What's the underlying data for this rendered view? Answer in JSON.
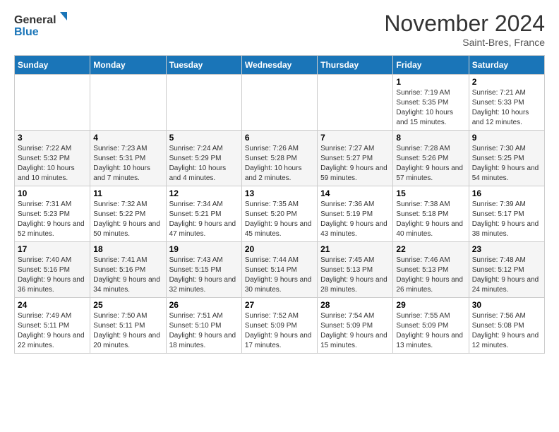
{
  "logo": {
    "name1": "General",
    "name2": "Blue"
  },
  "title": "November 2024",
  "subtitle": "Saint-Bres, France",
  "headers": [
    "Sunday",
    "Monday",
    "Tuesday",
    "Wednesday",
    "Thursday",
    "Friday",
    "Saturday"
  ],
  "rows": [
    [
      {
        "day": "",
        "info": ""
      },
      {
        "day": "",
        "info": ""
      },
      {
        "day": "",
        "info": ""
      },
      {
        "day": "",
        "info": ""
      },
      {
        "day": "",
        "info": ""
      },
      {
        "day": "1",
        "info": "Sunrise: 7:19 AM\nSunset: 5:35 PM\nDaylight: 10 hours and 15 minutes."
      },
      {
        "day": "2",
        "info": "Sunrise: 7:21 AM\nSunset: 5:33 PM\nDaylight: 10 hours and 12 minutes."
      }
    ],
    [
      {
        "day": "3",
        "info": "Sunrise: 7:22 AM\nSunset: 5:32 PM\nDaylight: 10 hours and 10 minutes."
      },
      {
        "day": "4",
        "info": "Sunrise: 7:23 AM\nSunset: 5:31 PM\nDaylight: 10 hours and 7 minutes."
      },
      {
        "day": "5",
        "info": "Sunrise: 7:24 AM\nSunset: 5:29 PM\nDaylight: 10 hours and 4 minutes."
      },
      {
        "day": "6",
        "info": "Sunrise: 7:26 AM\nSunset: 5:28 PM\nDaylight: 10 hours and 2 minutes."
      },
      {
        "day": "7",
        "info": "Sunrise: 7:27 AM\nSunset: 5:27 PM\nDaylight: 9 hours and 59 minutes."
      },
      {
        "day": "8",
        "info": "Sunrise: 7:28 AM\nSunset: 5:26 PM\nDaylight: 9 hours and 57 minutes."
      },
      {
        "day": "9",
        "info": "Sunrise: 7:30 AM\nSunset: 5:25 PM\nDaylight: 9 hours and 54 minutes."
      }
    ],
    [
      {
        "day": "10",
        "info": "Sunrise: 7:31 AM\nSunset: 5:23 PM\nDaylight: 9 hours and 52 minutes."
      },
      {
        "day": "11",
        "info": "Sunrise: 7:32 AM\nSunset: 5:22 PM\nDaylight: 9 hours and 50 minutes."
      },
      {
        "day": "12",
        "info": "Sunrise: 7:34 AM\nSunset: 5:21 PM\nDaylight: 9 hours and 47 minutes."
      },
      {
        "day": "13",
        "info": "Sunrise: 7:35 AM\nSunset: 5:20 PM\nDaylight: 9 hours and 45 minutes."
      },
      {
        "day": "14",
        "info": "Sunrise: 7:36 AM\nSunset: 5:19 PM\nDaylight: 9 hours and 43 minutes."
      },
      {
        "day": "15",
        "info": "Sunrise: 7:38 AM\nSunset: 5:18 PM\nDaylight: 9 hours and 40 minutes."
      },
      {
        "day": "16",
        "info": "Sunrise: 7:39 AM\nSunset: 5:17 PM\nDaylight: 9 hours and 38 minutes."
      }
    ],
    [
      {
        "day": "17",
        "info": "Sunrise: 7:40 AM\nSunset: 5:16 PM\nDaylight: 9 hours and 36 minutes."
      },
      {
        "day": "18",
        "info": "Sunrise: 7:41 AM\nSunset: 5:16 PM\nDaylight: 9 hours and 34 minutes."
      },
      {
        "day": "19",
        "info": "Sunrise: 7:43 AM\nSunset: 5:15 PM\nDaylight: 9 hours and 32 minutes."
      },
      {
        "day": "20",
        "info": "Sunrise: 7:44 AM\nSunset: 5:14 PM\nDaylight: 9 hours and 30 minutes."
      },
      {
        "day": "21",
        "info": "Sunrise: 7:45 AM\nSunset: 5:13 PM\nDaylight: 9 hours and 28 minutes."
      },
      {
        "day": "22",
        "info": "Sunrise: 7:46 AM\nSunset: 5:13 PM\nDaylight: 9 hours and 26 minutes."
      },
      {
        "day": "23",
        "info": "Sunrise: 7:48 AM\nSunset: 5:12 PM\nDaylight: 9 hours and 24 minutes."
      }
    ],
    [
      {
        "day": "24",
        "info": "Sunrise: 7:49 AM\nSunset: 5:11 PM\nDaylight: 9 hours and 22 minutes."
      },
      {
        "day": "25",
        "info": "Sunrise: 7:50 AM\nSunset: 5:11 PM\nDaylight: 9 hours and 20 minutes."
      },
      {
        "day": "26",
        "info": "Sunrise: 7:51 AM\nSunset: 5:10 PM\nDaylight: 9 hours and 18 minutes."
      },
      {
        "day": "27",
        "info": "Sunrise: 7:52 AM\nSunset: 5:09 PM\nDaylight: 9 hours and 17 minutes."
      },
      {
        "day": "28",
        "info": "Sunrise: 7:54 AM\nSunset: 5:09 PM\nDaylight: 9 hours and 15 minutes."
      },
      {
        "day": "29",
        "info": "Sunrise: 7:55 AM\nSunset: 5:09 PM\nDaylight: 9 hours and 13 minutes."
      },
      {
        "day": "30",
        "info": "Sunrise: 7:56 AM\nSunset: 5:08 PM\nDaylight: 9 hours and 12 minutes."
      }
    ]
  ]
}
